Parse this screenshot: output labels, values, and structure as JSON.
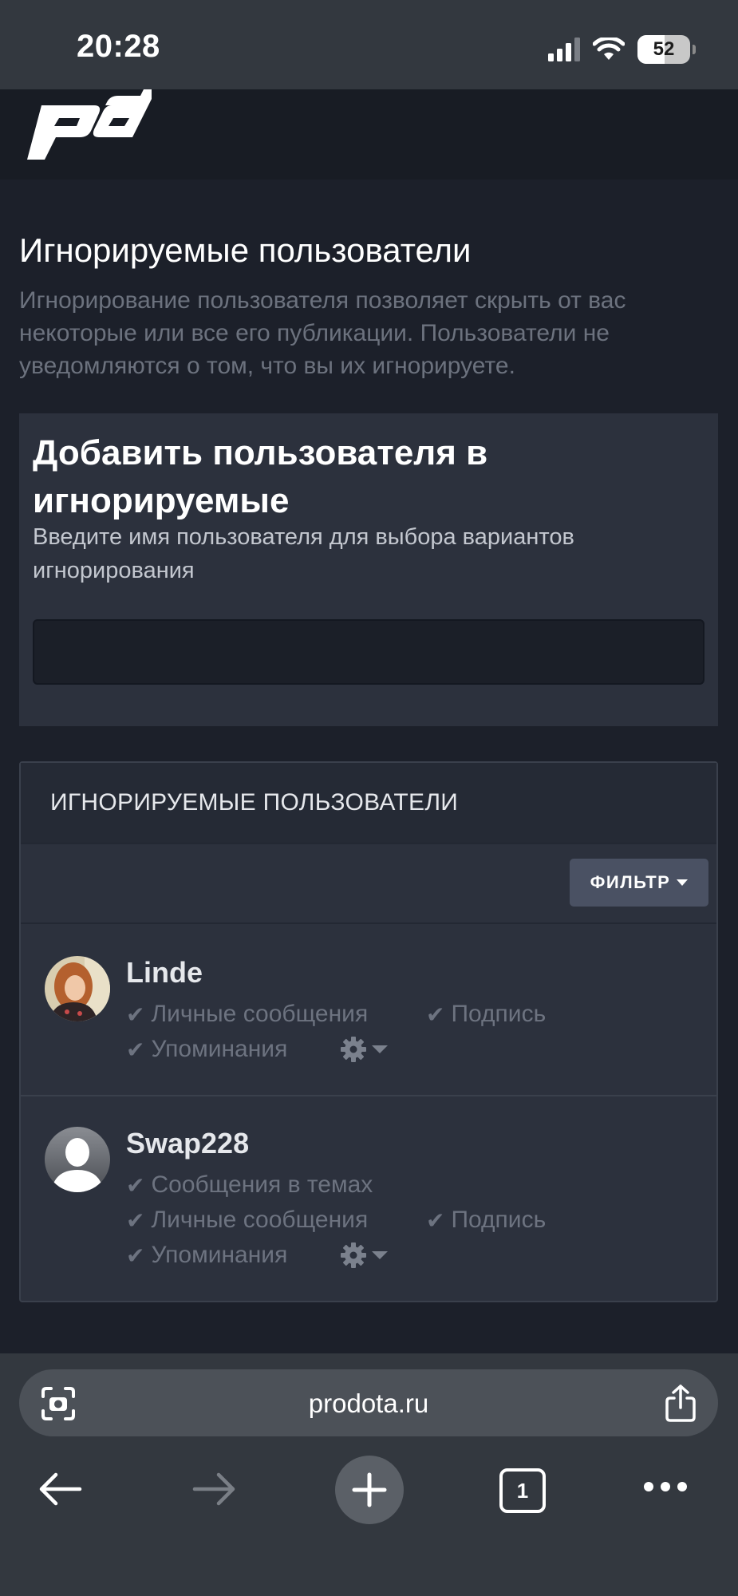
{
  "status_bar": {
    "time": "20:28",
    "battery": "52"
  },
  "page": {
    "title": "Игнорируемые пользователи",
    "description": "Игнорирование пользователя позволяет скрыть от вас некоторые или все его публикации. Пользователи не уведомляются о том, что вы их игнорируете."
  },
  "add_section": {
    "title": "Добавить пользователя в игнорируемые",
    "hint": "Введите имя пользователя для выбора вариантов игнорирования",
    "input_value": ""
  },
  "list_section": {
    "header": "ИГНОРИРУЕМЫЕ ПОЛЬЗОВАТЕЛИ",
    "filter_label": "ФИЛЬТР",
    "users": [
      {
        "name": "Linde",
        "options": [
          "Личные сообщения",
          "Подпись",
          "Упоминания"
        ]
      },
      {
        "name": "Swap228",
        "options": [
          "Сообщения в темах",
          "Личные сообщения",
          "Подпись",
          "Упоминания"
        ]
      }
    ]
  },
  "browser": {
    "url": "prodota.ru",
    "tab_count": "1"
  },
  "colors": {
    "background": "#1c202a",
    "panel": "#2c313d",
    "muted_text": "#6d7380",
    "filter_button": "#4a5163"
  },
  "icons": [
    "signal-icon",
    "wifi-icon",
    "battery-icon",
    "logo",
    "check-icon",
    "gear-icon",
    "chevron-down-icon",
    "camera-scan-icon",
    "share-icon",
    "back-arrow-icon",
    "forward-arrow-icon",
    "plus-icon",
    "tabs-icon",
    "more-icon"
  ]
}
